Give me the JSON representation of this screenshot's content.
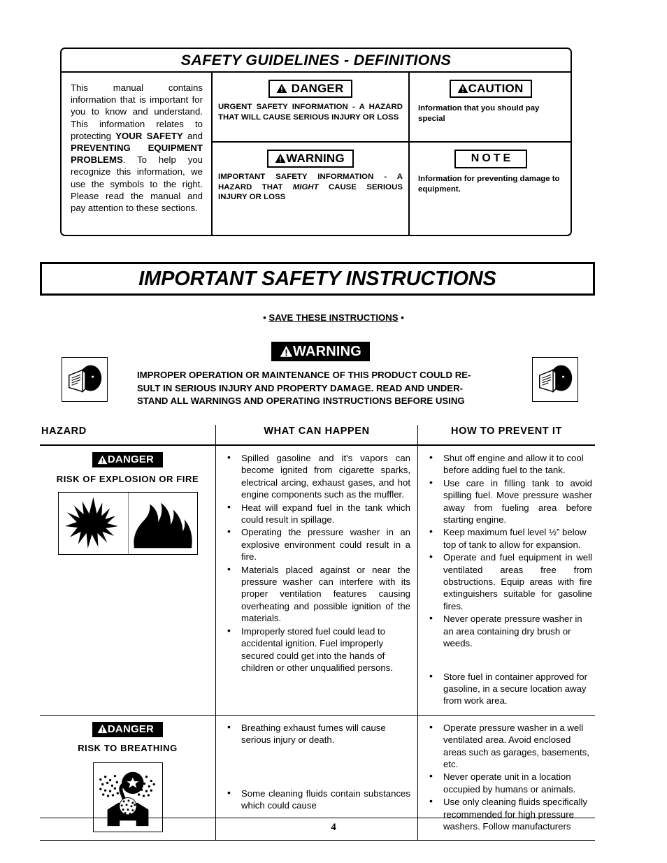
{
  "guidelines": {
    "title": "SAFETY GUIDELINES - DEFINITIONS",
    "intro_1": "This manual contains information that is important for you to know and understand. This information relates to protecting ",
    "intro_bold_1": "YOUR SAFETY",
    "intro_2": " and ",
    "intro_bold_2": "PREVENTING EQUIPMENT PROBLEMS",
    "intro_3": ". To help you recognize this information, we use the symbols to the right. Please read the manual and pay attention to these sections.",
    "danger_label": "DANGER",
    "danger_desc": "URGENT SAFETY INFORMATION - A HAZARD THAT WILL CAUSE SERIOUS INJURY OR LOSS",
    "caution_label": "CAUTION",
    "caution_desc": "Information that you should pay special",
    "warning_label": "WARNING",
    "warning_desc_1": "IMPORTANT SAFETY INFORMATION - A HAZARD THAT ",
    "warning_desc_italic": "MIGHT",
    "warning_desc_2": " CAUSE SERIOUS INJURY OR LOSS",
    "note_label": "NOTE",
    "note_desc": "Information for preventing damage to equipment."
  },
  "banner": {
    "title": "IMPORTANT SAFETY INSTRUCTIONS",
    "save_bullet_left": "• ",
    "save_text": "SAVE THESE INSTRUCTIONS",
    "save_bullet_right": " •"
  },
  "warning_block": {
    "label": "WARNING",
    "line1": "IMPROPER OPERATION OR MAINTENANCE OF THIS PRODUCT COULD RE-",
    "line2": "SULT IN SERIOUS INJURY AND PROPERTY DAMAGE. READ AND UNDER-",
    "line3": "STAND ALL WARNINGS AND OPERATING INSTRUCTIONS BEFORE USING",
    "icon_left_name": "read-manual-icon",
    "icon_right_name": "read-manual-icon"
  },
  "table": {
    "headers": [
      "HAZARD",
      "WHAT CAN HAPPEN",
      "HOW TO PREVENT IT"
    ],
    "rows": [
      {
        "tag": "DANGER",
        "label": "RISK OF EXPLOSION OR FIRE",
        "icons": [
          "explosion-icon",
          "fire-icon"
        ],
        "what_can_happen": [
          "Spilled gasoline and it's vapors can become ignited from cigarette sparks, electrical arcing, exhaust gases, and hot engine components such as the muffler.",
          "Heat will expand fuel in the tank which could result in spillage.",
          "Operating the pressure washer in an    explosive environment could result in a fire.",
          "Materials placed against or near the pressure washer can interfere with   its proper ventilation features causing overheating and possible ignition of the materials.",
          "Improperly stored fuel could lead to accidental ignition. Fuel improperly secured could get into the hands of children or other unqualified persons."
        ],
        "how_to_prevent": [
          "Shut off engine and allow it to cool before adding fuel to the tank.",
          "Use care in filling tank to avoid spilling fuel.  Move pressure washer away from fueling area before starting engine.",
          "Keep maximum fuel level ½” below top of tank to allow for expansion.",
          "Operate and fuel equipment in well ventilated areas free from obstructions.  Equip areas with fire extinguishers suitable for gasoline fires.",
          "Never operate pressure washer in an area containing dry brush or weeds.",
          "Store fuel in container approved for gasoline, in a secure location away from work area."
        ],
        "prevent_spacer_before_index": 5
      },
      {
        "tag": "DANGER",
        "label": "RISK TO BREATHING",
        "icons": [
          "breathing-hazard-icon"
        ],
        "what_can_happen": [
          "Breathing exhaust fumes will cause serious injury or death.",
          "Some cleaning fluids contain substances which could cause"
        ],
        "what_spacer_before_index": 1,
        "how_to_prevent": [
          "Operate pressure washer in a well ventilated area.  Avoid enclosed areas such as garages, basements, etc.",
          "Never operate unit in a location occupied by humans or animals.",
          "Use only cleaning fluids specifically recommended for high pressure washers.  Follow manufacturers"
        ]
      }
    ]
  },
  "footer": {
    "page_number": "4"
  },
  "colors": {
    "ink": "#000000",
    "paper": "#ffffff"
  }
}
